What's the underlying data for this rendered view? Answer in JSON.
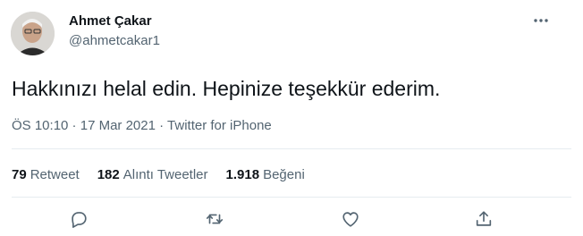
{
  "author": {
    "name": "Ahmet Çakar",
    "handle": "@ahmetcakar1"
  },
  "tweet": {
    "text": "Hakkınızı helal edin. Hepinize teşekkür ederim.",
    "time": "ÖS 10:10",
    "separator": " · ",
    "date": "17 Mar 2021",
    "source": "Twitter for iPhone"
  },
  "stats": {
    "retweets_count": "79",
    "retweets_label": "Retweet",
    "quotes_count": "182",
    "quotes_label": "Alıntı Tweetler",
    "likes_count": "1.918",
    "likes_label": "Beğeni"
  },
  "icons": {
    "more": "more-icon",
    "reply": "reply-icon",
    "retweet": "retweet-icon",
    "like": "like-icon",
    "share": "share-icon"
  },
  "colors": {
    "text": "#0f1419",
    "secondary": "#536471",
    "divider": "#e6ecf0"
  }
}
